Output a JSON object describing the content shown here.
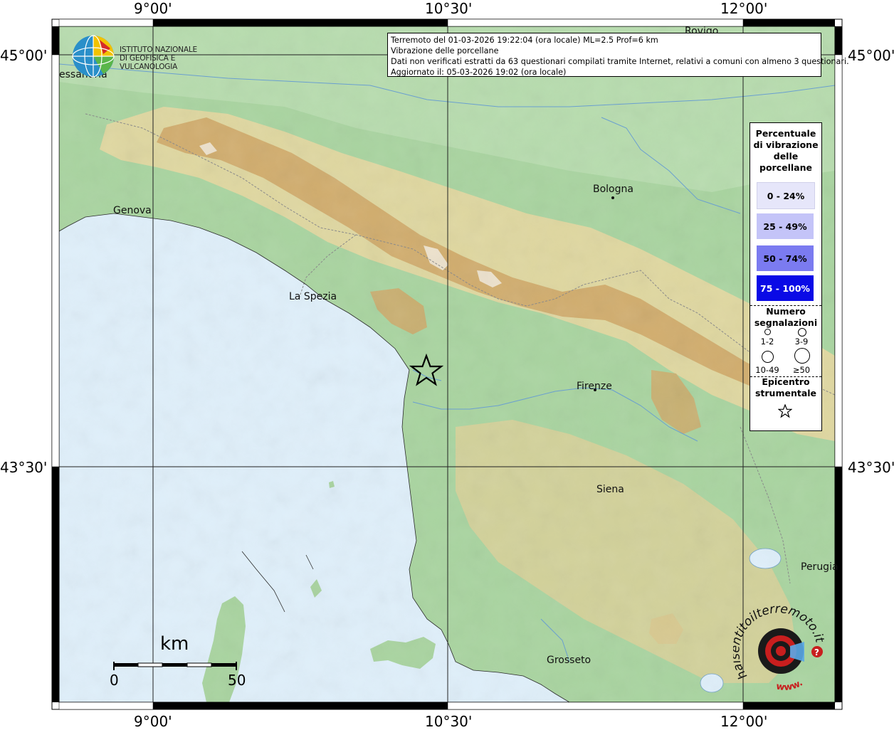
{
  "axes": {
    "top_labels": [
      "9°00'",
      "10°30'",
      "12°00'"
    ],
    "bottom_labels": [
      "9°00'",
      "10°30'",
      "12°00'"
    ],
    "left_labels": [
      "45°00'",
      "43°30'"
    ],
    "right_labels": [
      "45°00'",
      "43°30'"
    ]
  },
  "info": {
    "line1": "Terremoto del 01-03-2026 19:22:04 (ora locale) ML=2.5 Prof=6 km",
    "line2": "Vibrazione delle porcellane",
    "line3": "Dati non verificati estratti da 63 questionari compilati tramite Internet, relativi a comuni con almeno 3 questionari.",
    "line4": "Aggiornato il: 05-03-2026 19:02 (ora locale)"
  },
  "places": [
    {
      "name": "Rovigo"
    },
    {
      "name": "essandria"
    },
    {
      "name": "Genova"
    },
    {
      "name": "Bologna"
    },
    {
      "name": "La Spezia"
    },
    {
      "name": "Firenze"
    },
    {
      "name": "Siena"
    },
    {
      "name": "Perugia"
    },
    {
      "name": "Grosseto"
    }
  ],
  "logo": {
    "line1": "ISTITUTO NAZIONALE",
    "line2": "DI GEOFISICA E VULCANOLOGIA"
  },
  "legend": {
    "title": [
      "Percentuale",
      "di vibrazione",
      "delle",
      "porcellane"
    ],
    "classes": [
      {
        "label": "0 - 24%",
        "color": "#e6e6fa"
      },
      {
        "label": "25 - 49%",
        "color": "#c4c4f8"
      },
      {
        "label": "50 - 74%",
        "color": "#7b7bf0"
      },
      {
        "label": "75 - 100%",
        "color": "#0a0ae6"
      }
    ],
    "count_title": [
      "Numero",
      "segnalazioni"
    ],
    "count_classes": [
      "1-2",
      "3-9",
      "10-49",
      "≥50"
    ],
    "epi_title": [
      "Epicentro",
      "strumentale"
    ]
  },
  "scale": {
    "unit": "km",
    "start": "0",
    "end": "50"
  },
  "badge": {
    "text": "haisentitoilterremoto.it",
    "sub": "www."
  },
  "colors": {
    "sea": "#dfeffa",
    "lowland": "#a9d4a0",
    "hills": "#e7dca8",
    "mountains": "#c79c5c",
    "peaks": "#f3eee4"
  }
}
